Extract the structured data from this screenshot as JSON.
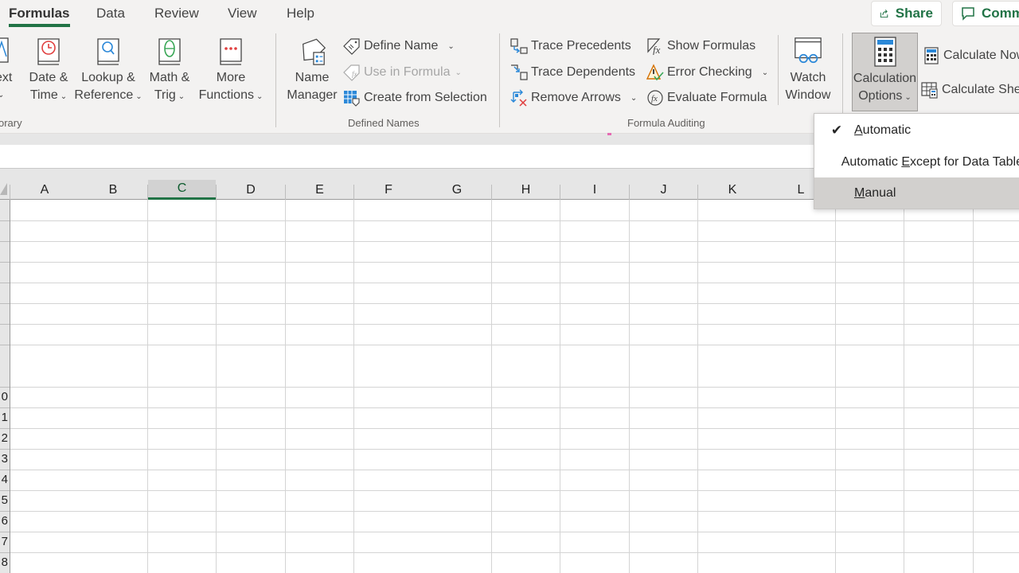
{
  "tabs": [
    {
      "label": "Formulas",
      "active": true
    },
    {
      "label": "Data",
      "active": false
    },
    {
      "label": "Review",
      "active": false
    },
    {
      "label": "View",
      "active": false
    },
    {
      "label": "Help",
      "active": false
    }
  ],
  "header_buttons": {
    "share": "Share",
    "comments": "Comm"
  },
  "ribbon": {
    "function_library": {
      "label": "orary",
      "buttons": [
        {
          "line1": "ext",
          "line2": ""
        },
        {
          "line1": "Date &",
          "line2": "Time"
        },
        {
          "line1": "Lookup &",
          "line2": "Reference"
        },
        {
          "line1": "Math &",
          "line2": "Trig"
        },
        {
          "line1": "More",
          "line2": "Functions"
        }
      ]
    },
    "defined_names": {
      "label": "Defined Names",
      "name_manager": {
        "line1": "Name",
        "line2": "Manager"
      },
      "define_name": "Define Name",
      "use_in_formula": "Use in Formula",
      "create_from_selection": "Create from Selection"
    },
    "formula_auditing": {
      "label": "Formula Auditing",
      "trace_precedents": "Trace Precedents",
      "trace_dependents": "Trace Dependents",
      "remove_arrows": "Remove Arrows",
      "show_formulas": "Show Formulas",
      "error_checking": "Error Checking",
      "evaluate_formula": "Evaluate Formula",
      "watch_window": {
        "line1": "Watch",
        "line2": "Window"
      }
    },
    "calculation": {
      "calculation_options": {
        "line1": "Calculation",
        "line2": "Options"
      },
      "calculate_now": "Calculate Now",
      "calculate_sheet": "Calculate Sheet"
    }
  },
  "calc_menu": {
    "items": [
      {
        "pre": "",
        "ul": "A",
        "post": "utomatic",
        "checked": true
      },
      {
        "pre": "Automatic ",
        "ul": "E",
        "post": "xcept for Data Tables",
        "checked": false
      },
      {
        "pre": "",
        "ul": "M",
        "post": "anual",
        "checked": false
      }
    ]
  },
  "grid": {
    "columns": [
      "A",
      "B",
      "C",
      "D",
      "E",
      "F",
      "G",
      "H",
      "I",
      "J",
      "K",
      "L"
    ],
    "selected_column": "C",
    "row_labels": [
      "0",
      "1",
      "2",
      "3",
      "4",
      "5",
      "6",
      "7",
      "8"
    ]
  }
}
